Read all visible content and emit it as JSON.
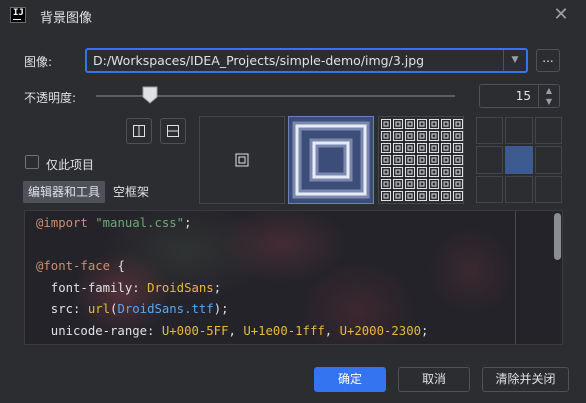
{
  "window": {
    "title": "背景图像",
    "close_icon": "close-icon",
    "logo_text": "IJ"
  },
  "image": {
    "label": "图像:",
    "path": "D:/Workspaces/IDEA_Projects/simple-demo/img/3.jpg",
    "browse_label": "..."
  },
  "opacity": {
    "label": "不透明度:",
    "value": "15",
    "slider_fraction": 0.15
  },
  "flip": {
    "horizontal_icon": "flip-horizontal-icon",
    "vertical_icon": "flip-vertical-icon"
  },
  "only_project": {
    "label": "仅此项目",
    "checked": false
  },
  "tabs": {
    "editor": "编辑器和工具",
    "frame": "空框架"
  },
  "fill_modes": [
    "center",
    "scale",
    "tile"
  ],
  "anchor": {
    "selected": "center"
  },
  "preview": {
    "lines": [
      [
        {
          "c": "kw",
          "t": "@import"
        },
        {
          "c": "punc",
          "t": " "
        },
        {
          "c": "str",
          "t": "\"manual.css\""
        },
        {
          "c": "punc",
          "t": ";"
        }
      ],
      [],
      [
        {
          "c": "kw",
          "t": "@font-face"
        },
        {
          "c": "punc",
          "t": " {"
        }
      ],
      [
        {
          "c": "prop",
          "t": "  font-family: "
        },
        {
          "c": "val",
          "t": "DroidSans"
        },
        {
          "c": "punc",
          "t": ";"
        }
      ],
      [
        {
          "c": "prop",
          "t": "  src: "
        },
        {
          "c": "val",
          "t": "url"
        },
        {
          "c": "punc",
          "t": "("
        },
        {
          "c": "url",
          "t": "DroidSans.ttf"
        },
        {
          "c": "punc",
          "t": ");"
        }
      ],
      [
        {
          "c": "prop",
          "t": "  unicode-range: "
        },
        {
          "c": "val",
          "t": "U+000-5FF"
        },
        {
          "c": "punc",
          "t": ", "
        },
        {
          "c": "val",
          "t": "U+1e00-1fff"
        },
        {
          "c": "punc",
          "t": ", "
        },
        {
          "c": "val",
          "t": "U+2000-2300"
        },
        {
          "c": "punc",
          "t": ";"
        }
      ]
    ]
  },
  "buttons": {
    "ok": "确定",
    "cancel": "取消",
    "clear_close": "清除并关闭"
  },
  "colors": {
    "accent": "#3574f0",
    "background": "#2b2d30"
  }
}
